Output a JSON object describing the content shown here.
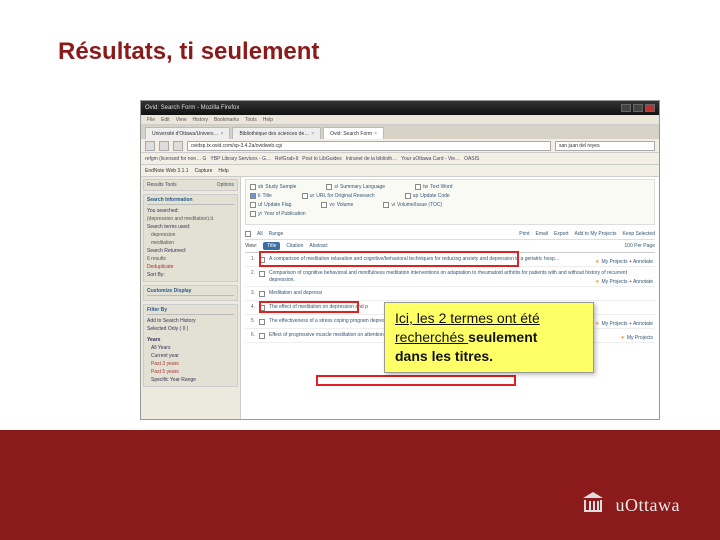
{
  "slide_title": "Résultats, ti seulement",
  "window": {
    "title": "Ovid: Search Form - Mozilla Firefox",
    "menu": [
      "File",
      "Edit",
      "View",
      "History",
      "Bookmarks",
      "Tools",
      "Help"
    ],
    "tabs": [
      {
        "label": "Université d'Ottawa/Univers…"
      },
      {
        "label": "Bibliothèque des sciences de…"
      },
      {
        "label": "Ovid: Search Form"
      }
    ],
    "nav": {
      "back": "◄",
      "fwd": "►",
      "reload": "⟳"
    },
    "address": "ovidsp.tx.ovid.com/sp-3.4.2a/ovidweb.cgi",
    "search_placeholder": "san juan del reyes",
    "bookmarks": [
      "refgm (licensed for non… G",
      "YBP Library Services - G…",
      "RefGrab-It",
      "Post to LibGuides",
      "Intranet de la biblioth…",
      "Your uOttawa Card - Vie…",
      "OASIS"
    ],
    "toolbar": [
      "EndNote Web 3.1.1",
      "Capture",
      "Help"
    ]
  },
  "left": {
    "results_tools": "Results Tools",
    "options": "Options",
    "search_info_hdr": "Search Information",
    "you_searched": "You searched:",
    "query": "(depression and meditation).ti.",
    "terms_used_lbl": "Search terms used:",
    "terms": [
      "depression",
      "meditation"
    ],
    "returned_lbl": "Search Returned:",
    "returned": "6 results",
    "dedup": "Deduplicate",
    "sortby": "Sort By:",
    "custom_hdr": "Customize Display",
    "filter_hdr": "Filter By",
    "filters": [
      "Add to Search History",
      "Selected Only ( 0 )"
    ],
    "years_hdr": "Years",
    "years": [
      "All Years",
      "Current year",
      "Past 3 years",
      "Past 5 years",
      "Specific Year Range"
    ]
  },
  "fields": {
    "row1": [
      {
        "k": "sb",
        "l": "Study Sample"
      },
      {
        "k": "sl",
        "l": "Summary Language"
      },
      {
        "k": "tw",
        "l": "Text Word"
      }
    ],
    "row2": [
      {
        "k": "ti",
        "l": "Title",
        "on": true
      },
      {
        "k": "ur",
        "l": "URL for Original Research"
      },
      {
        "k": "up",
        "l": "Update Code"
      }
    ],
    "row3": [
      {
        "k": "uf",
        "l": "Update Flag"
      },
      {
        "k": "vo",
        "l": "Volume"
      },
      {
        "k": "vi",
        "l": "Volume/Issue (TOC)"
      }
    ],
    "row4": [
      {
        "k": "yr",
        "l": "Year of Publication"
      }
    ]
  },
  "resultbar": {
    "all": "All",
    "range": "Range",
    "print": "Print",
    "email": "Email",
    "export": "Export",
    "add": "Add to My Projects",
    "keep": "Keep Selected",
    "view": "View:",
    "vtitle": "Title",
    "vcite": "Citation",
    "vabs": "Abstract",
    "perpage": "100 Per Page"
  },
  "results": [
    {
      "n": "1.",
      "title": "A comparison of meditation relaxation and cognitive/behavioral techniques for reducing anxiety and depression in a geriatric hosp…",
      "links": "My Projects  + Annotate"
    },
    {
      "n": "2.",
      "title": "Comparison of cognitive behavioral and mindfulness meditation interventions on adaptation to rheumatoid arthritis for patients with and without history of recurrent depression.",
      "links": "My Projects  + Annotate"
    },
    {
      "n": "3.",
      "title": "Meditation and depressi",
      "links": ""
    },
    {
      "n": "4.",
      "title": "The effect of meditation on depression and p",
      "links": ""
    },
    {
      "n": "5.",
      "title": "The effectiveness of a stress coping program depression experienced by nursing students",
      "links": "My Projects  + Annotate"
    },
    {
      "n": "6.",
      "title": "Effect of progressive muscle meditation on attention, anxiety, and depression scores.",
      "links": "My Projects"
    }
  ],
  "annotation": {
    "l1": "Ici, les 2 termes ont été",
    "l2a": "recherchés ",
    "l2b": "seulement",
    "l3": "dans les titres."
  },
  "footer": {
    "uni": "uOttawa"
  }
}
